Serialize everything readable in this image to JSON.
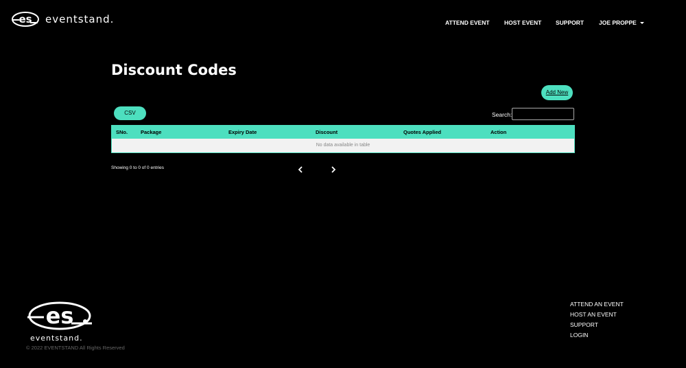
{
  "brand": {
    "logo_mark": "es",
    "name": "eventstand."
  },
  "nav": {
    "items": [
      {
        "label": "ATTEND EVENT"
      },
      {
        "label": "HOST EVENT"
      },
      {
        "label": "SUPPORT"
      },
      {
        "label": "JOE PROPPE"
      }
    ]
  },
  "main": {
    "title": "Discount Codes",
    "add_new_label": "Add New",
    "csv_label": "CSV",
    "search_label": "Search:",
    "search_value": "",
    "table": {
      "columns": [
        "SNo.",
        "Package",
        "Expiry Date",
        "Discount",
        "Quotes Applied",
        "Action"
      ],
      "empty_message": "No data available in table"
    },
    "entries_info": "Showing 0 to 0 of 0 entries",
    "pagination": {
      "prev_icon": "chevron-left-icon",
      "next_icon": "chevron-right-icon"
    }
  },
  "footer": {
    "logo_mark": "es",
    "logo_text": "eventstand.",
    "copyright": "© 2022 EVENTSTAND All Rights Reserved",
    "links": [
      {
        "label": "ATTEND AN EVENT"
      },
      {
        "label": "HOST AN EVENT"
      },
      {
        "label": "SUPPORT"
      },
      {
        "label": "LOGIN"
      }
    ]
  },
  "colors": {
    "accent": "#4ddfbf",
    "background": "#000000",
    "table_body": "#f2f2f2"
  }
}
